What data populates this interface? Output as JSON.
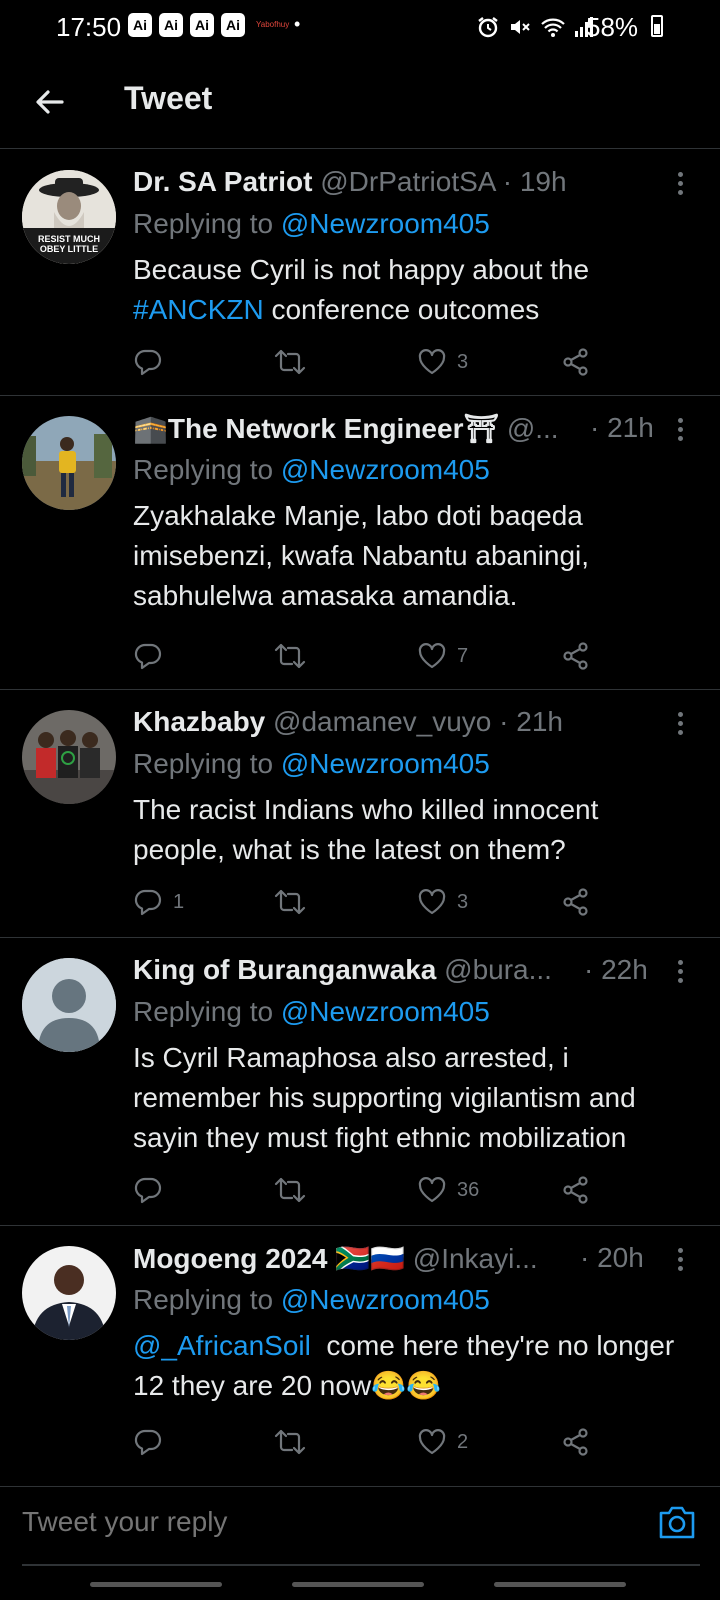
{
  "status_bar": {
    "time": "17:50",
    "ai_badges": [
      "Ai",
      "Ai",
      "Ai",
      "Ai"
    ],
    "tiny_app_label": "Yabofhuy",
    "battery": "58%",
    "icons": [
      "alarm-icon",
      "mute-icon",
      "wifi-icon",
      "signal-icon",
      "battery-icon"
    ]
  },
  "header": {
    "title": "Tweet",
    "back_icon": "arrow-left-icon"
  },
  "accent_color": "#1d9bf0",
  "tweets": [
    {
      "name": "Dr. SA Patriot",
      "handle": "@DrPatriotSA",
      "sep": " · ",
      "time": "19h",
      "replying_label": "Replying to ",
      "replying_to": "@Newzroom405",
      "body_pre": "Because Cyril is not happy about the ",
      "body_tag": "#ANCKZN",
      "body_post": " conference outcomes",
      "avatar_text": "RESIST MUCH OBEY LITTLE",
      "replies": "",
      "retweets": "",
      "likes": "3"
    },
    {
      "name": "🕋The Network Engineer⛩",
      "handle": "@...",
      "sep": " · ",
      "time": "21h",
      "replying_label": "Replying to ",
      "replying_to": "@Newzroom405",
      "body": "Zyakhalake Manje, labo doti baqeda imisebenzi, kwafa Nabantu abaningi, sabhulelwa amasaka amandia.",
      "replies": "",
      "retweets": "",
      "likes": "7"
    },
    {
      "name": "Khazbaby",
      "handle": "@damanev_vuyo",
      "sep": " · ",
      "time": "21h",
      "replying_label": "Replying to ",
      "replying_to": "@Newzroom405",
      "body": "The racist Indians who killed innocent people, what is the latest on them?",
      "replies": "1",
      "retweets": "",
      "likes": "3"
    },
    {
      "name": "King of Buranganwaka",
      "handle": "@bura...",
      "sep": " · ",
      "time": "22h",
      "replying_label": "Replying to ",
      "replying_to": "@Newzroom405",
      "body": "Is Cyril Ramaphosa also arrested, i remember his supporting vigilantism and sayin they must fight ethnic mobilization",
      "replies": "",
      "retweets": "",
      "likes": "36"
    },
    {
      "name": "Mogoeng 2024 🇿🇦🇷🇺",
      "handle": "@Inkayi...",
      "sep": " · ",
      "time": "20h",
      "replying_label": "Replying to ",
      "replying_to": "@Newzroom405",
      "body_mention": "@_AfricanSoil",
      "body_post": "  come here they're no longer 12 they are 20 now😂😂",
      "replies": "",
      "retweets": "",
      "likes": "2"
    }
  ],
  "composer": {
    "placeholder": "Tweet your reply",
    "camera_icon": "camera-icon"
  }
}
